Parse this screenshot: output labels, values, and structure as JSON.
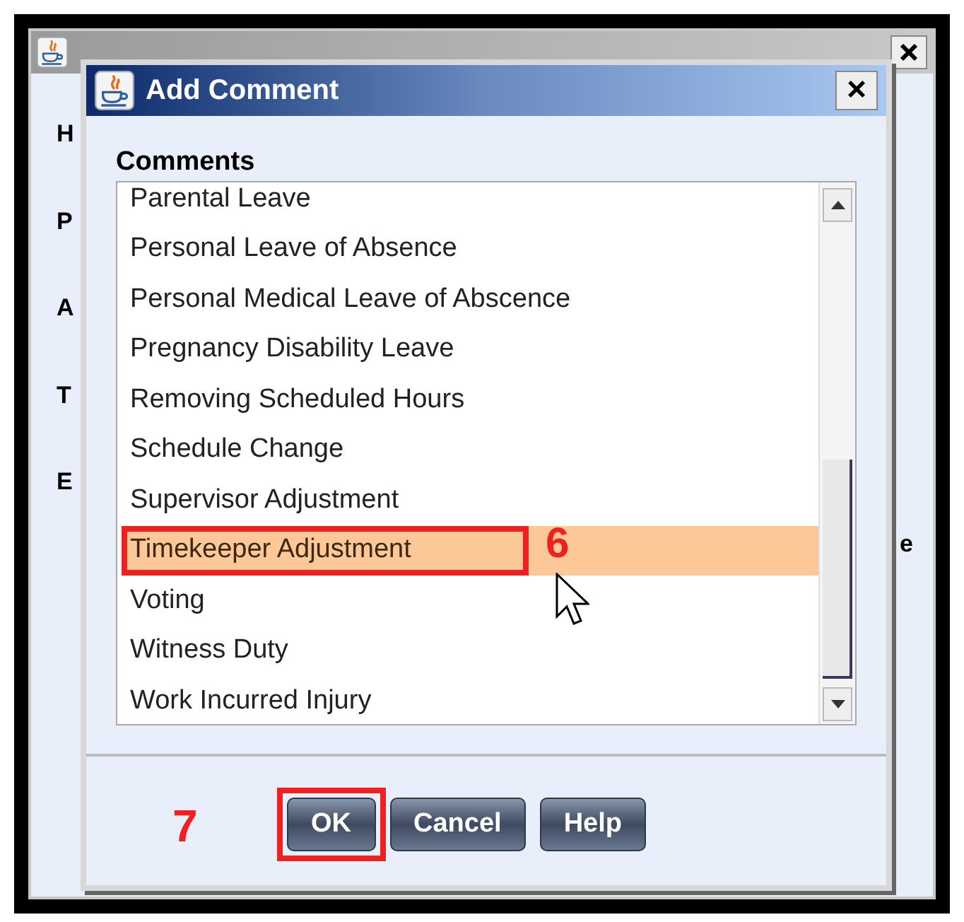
{
  "background_window": {
    "labels": [
      "H",
      "P",
      "A",
      "T",
      "E"
    ],
    "right_label": "e"
  },
  "dialog": {
    "title": "Add Comment",
    "close": "×"
  },
  "comments": {
    "label": "Comments",
    "items": [
      {
        "label": "Parental Leave",
        "selected": false
      },
      {
        "label": "Personal Leave of Absence",
        "selected": false
      },
      {
        "label": "Personal Medical Leave of Abscence",
        "selected": false
      },
      {
        "label": "Pregnancy Disability Leave",
        "selected": false
      },
      {
        "label": "Removing Scheduled Hours",
        "selected": false
      },
      {
        "label": "Schedule Change",
        "selected": false
      },
      {
        "label": "Supervisor Adjustment",
        "selected": false
      },
      {
        "label": "Timekeeper Adjustment",
        "selected": true
      },
      {
        "label": "Voting",
        "selected": false
      },
      {
        "label": "Witness Duty",
        "selected": false
      },
      {
        "label": "Work Incurred Injury",
        "selected": false
      }
    ]
  },
  "buttons": [
    {
      "label": "OK",
      "highlighted": true
    },
    {
      "label": "Cancel",
      "highlighted": false
    },
    {
      "label": "Help",
      "highlighted": false
    }
  ],
  "annotations": {
    "list_step": "6",
    "button_step": "7"
  }
}
